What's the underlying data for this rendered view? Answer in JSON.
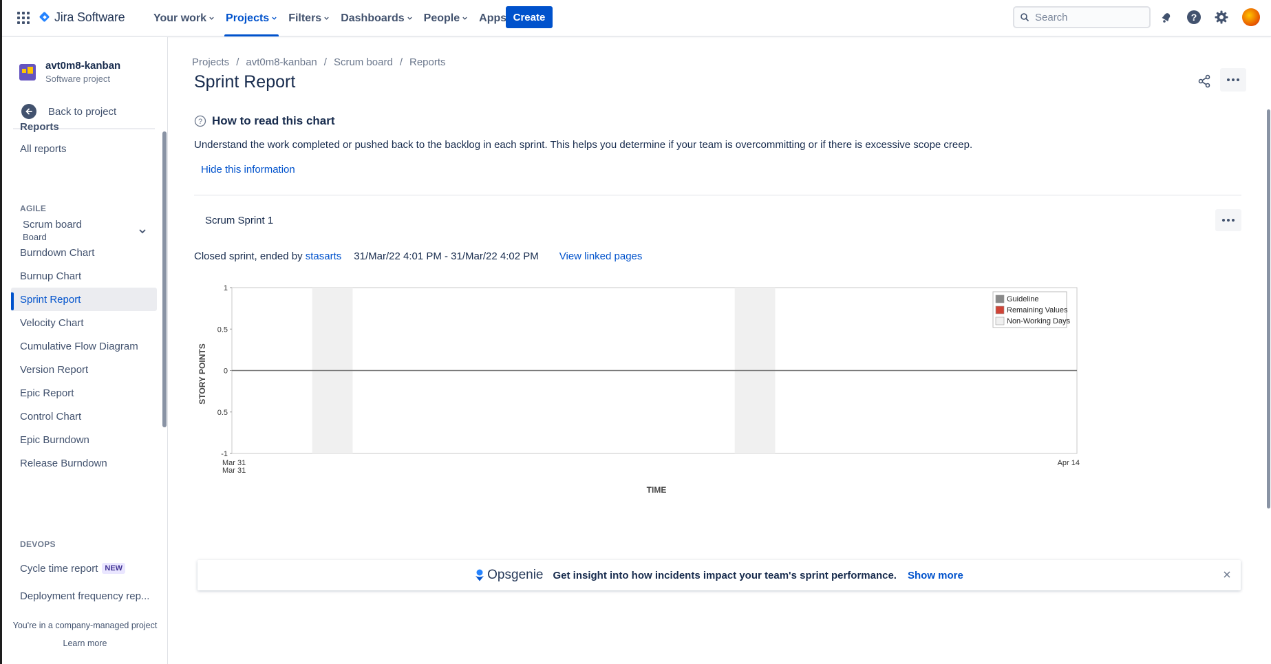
{
  "topbar": {
    "logo_text": "Jira Software",
    "nav": [
      {
        "label": "Your work",
        "active": false
      },
      {
        "label": "Projects",
        "active": true
      },
      {
        "label": "Filters",
        "active": false
      },
      {
        "label": "Dashboards",
        "active": false
      },
      {
        "label": "People",
        "active": false
      },
      {
        "label": "Apps",
        "active": false
      }
    ],
    "create_label": "Create",
    "search_placeholder": "Search",
    "icons": [
      "notifications-icon",
      "help-icon",
      "settings-icon",
      "avatar"
    ]
  },
  "sidebar": {
    "project_name": "avt0m8-kanban",
    "project_type": "Software project",
    "back_label": "Back to project",
    "reports_heading": "Reports",
    "all_reports": "All reports",
    "agile_group": "AGILE",
    "board_name": "Scrum board",
    "board_type": "Board",
    "agile_items": [
      {
        "label": "Burndown Chart",
        "selected": false
      },
      {
        "label": "Burnup Chart",
        "selected": false
      },
      {
        "label": "Sprint Report",
        "selected": true
      },
      {
        "label": "Velocity Chart",
        "selected": false
      },
      {
        "label": "Cumulative Flow Diagram",
        "selected": false
      },
      {
        "label": "Version Report",
        "selected": false
      },
      {
        "label": "Epic Report",
        "selected": false
      },
      {
        "label": "Control Chart",
        "selected": false
      },
      {
        "label": "Epic Burndown",
        "selected": false
      },
      {
        "label": "Release Burndown",
        "selected": false
      }
    ],
    "devops_group": "DEVOPS",
    "devops_items": [
      {
        "label": "Cycle time report",
        "badge": "NEW"
      },
      {
        "label": "Deployment frequency rep..."
      }
    ],
    "footer_text": "You're in a company-managed project",
    "footer_link": "Learn more"
  },
  "main": {
    "breadcrumbs": [
      "Projects",
      "avt0m8-kanban",
      "Scrum board",
      "Reports"
    ],
    "title": "Sprint Report",
    "howto_title": "How to read this chart",
    "info_text": "Understand the work completed or pushed back to the backlog in each sprint. This helps you determine if your team is overcommitting or if there is excessive scope creep.",
    "hide_link": "Hide this information",
    "sprint_name": "Scrum Sprint 1",
    "closed_prefix": "Closed sprint, ended by ",
    "ended_by": "stasarts",
    "date_range": "31/Mar/22 4:01 PM - 31/Mar/22 4:02 PM",
    "linked_pages": "View linked pages"
  },
  "chart_data": {
    "type": "line",
    "xlabel": "TIME",
    "ylabel": "STORY POINTS",
    "ylim": [
      -1,
      1
    ],
    "y_ticks": [
      "1",
      "0.5",
      "0",
      "0.5",
      "-1"
    ],
    "x_ticks": [
      "Mar 31",
      "Apr 14"
    ],
    "x_tick_sub": "Mar 31",
    "legend_position": "top-right",
    "series": [
      {
        "name": "Guideline",
        "color": "#8a8a8a",
        "values": [
          0,
          0
        ]
      },
      {
        "name": "Remaining Values",
        "color": "#d04437",
        "values": []
      },
      {
        "name": "Non-Working Days",
        "color": "#f0f0f0",
        "values": []
      }
    ],
    "non_working_ranges": [
      [
        "Apr 2",
        "Apr 3"
      ],
      [
        "Apr 9",
        "Apr 10"
      ]
    ]
  },
  "banner": {
    "brand": "Opsgenie",
    "text": "Get insight into how incidents impact your team's sprint performance.",
    "link": "Show more"
  }
}
